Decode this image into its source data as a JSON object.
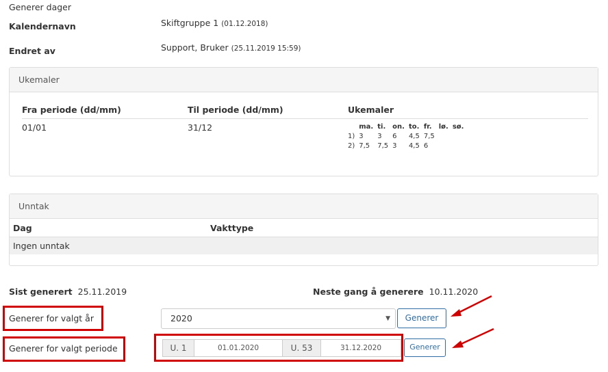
{
  "page": {
    "title": "Generer dager",
    "calendar_name_label": "Kalendernavn",
    "calendar_name_value": "Skiftgruppe 1",
    "calendar_name_date": "(01.12.2018)",
    "changed_by_label": "Endret av",
    "changed_by_value": "Support, Bruker",
    "changed_by_date": "(25.11.2019 15:59)"
  },
  "ukemaler": {
    "title": "Ukemaler",
    "col_from": "Fra periode (dd/mm)",
    "col_to": "Til periode (dd/mm)",
    "col_templates": "Ukemaler",
    "row": {
      "from": "01/01",
      "to": "31/12"
    },
    "days": [
      "ma.",
      "ti.",
      "on.",
      "to.",
      "fr.",
      "lø.",
      "sø."
    ],
    "weeks": [
      {
        "num": "1)",
        "vals": [
          "3",
          "3",
          "6",
          "4,5",
          "7,5",
          "",
          ""
        ]
      },
      {
        "num": "2)",
        "vals": [
          "7,5",
          "7,5",
          "3",
          "4,5",
          "6",
          "",
          ""
        ]
      }
    ]
  },
  "unntak": {
    "title": "Unntak",
    "col_day": "Dag",
    "col_type": "Vakttype",
    "empty": "Ingen unntak"
  },
  "generate": {
    "last_label": "Sist generert",
    "last_value": "25.11.2019",
    "next_label": "Neste gang å generere",
    "next_value": "10.11.2020",
    "year_label": "Generer for valgt år",
    "year_value": "2020",
    "period_label": "Generer for valgt periode",
    "week_from": "U. 1",
    "date_from": "01.01.2020",
    "week_to": "U. 53",
    "date_to": "31.12.2020",
    "button_label": "Generer"
  },
  "colors": {
    "annotation_red": "#d00000",
    "button_blue": "#2e6da4"
  },
  "icons": {
    "select_caret": "▼"
  }
}
